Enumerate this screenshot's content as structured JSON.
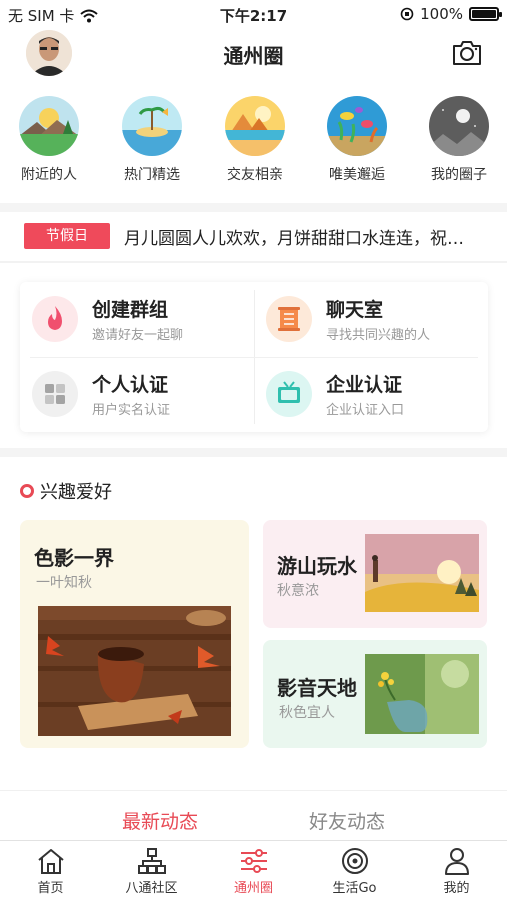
{
  "status_bar": {
    "carrier": "无 SIM 卡",
    "time": "下午2:17",
    "battery_text": "100%",
    "battery_level": 1.0
  },
  "header": {
    "title": "通州圈",
    "avatar_icon": "user-avatar",
    "camera_icon": "camera-icon"
  },
  "categories": [
    {
      "label": "附近的人",
      "icon": "landscape-icon"
    },
    {
      "label": "热门精选",
      "icon": "island-icon"
    },
    {
      "label": "交友相亲",
      "icon": "desert-icon"
    },
    {
      "label": "唯美邂逅",
      "icon": "underwater-icon"
    },
    {
      "label": "我的圈子",
      "icon": "moon-icon"
    }
  ],
  "ticker": {
    "tag": "节假日",
    "text": "月儿圆圆人儿欢欢，月饼甜甜口水连连，祝…"
  },
  "quick_actions": [
    {
      "title": "创建群组",
      "sub": "邀请好友一起聊",
      "icon": "flame-icon",
      "color": "#f0506e",
      "bg": "#fde8ea"
    },
    {
      "title": "聊天室",
      "sub": "寻找共同兴趣的人",
      "icon": "scroll-icon",
      "color": "#f58a4a",
      "bg": "#fde9d9"
    },
    {
      "title": "个人认证",
      "sub": "用户实名认证",
      "icon": "grid-icon",
      "color": "#a4a4a4",
      "bg": "#f0f0f0"
    },
    {
      "title": "企业认证",
      "sub": "企业认证入口",
      "icon": "tv-icon",
      "color": "#2fbfae",
      "bg": "#dcf6f2"
    }
  ],
  "interests": {
    "title": "兴趣爱好",
    "cards": [
      {
        "title": "色影一界",
        "sub": "一叶知秋",
        "bg": "#fbf7e6"
      },
      {
        "title": "游山玩水",
        "sub": "秋意浓",
        "bg": "#fbeef2"
      },
      {
        "title": "影音天地",
        "sub": "秋色宜人",
        "bg": "#eaf7ef"
      }
    ]
  },
  "feed_tabs": [
    {
      "label": "最新动态",
      "active": true
    },
    {
      "label": "好友动态",
      "active": false
    }
  ],
  "tab_bar": [
    {
      "label": "首页",
      "icon": "home-icon",
      "active": false
    },
    {
      "label": "八通社区",
      "icon": "network-icon",
      "active": false
    },
    {
      "label": "通州圈",
      "icon": "sliders-icon",
      "active": true
    },
    {
      "label": "生活Go",
      "icon": "target-icon",
      "active": false
    },
    {
      "label": "我的",
      "icon": "person-icon",
      "active": false
    }
  ],
  "colors": {
    "accent": "#e84a55",
    "text": "#222222",
    "muted": "#999999"
  }
}
